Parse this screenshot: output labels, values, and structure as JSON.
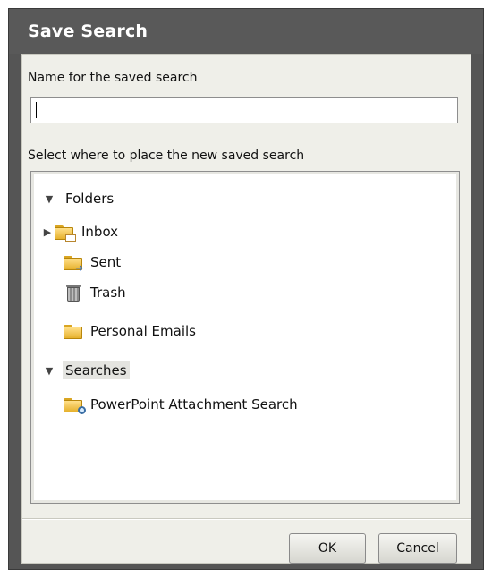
{
  "dialog": {
    "title": "Save Search"
  },
  "name_field": {
    "label": "Name for the saved search",
    "value": ""
  },
  "location": {
    "label": "Select where to place the new saved search"
  },
  "tree": {
    "folders": {
      "label": "Folders",
      "twisty": "▼",
      "items": [
        {
          "label": "Inbox",
          "icon": "inbox-folder-icon",
          "twisty": "▶"
        },
        {
          "label": "Sent",
          "icon": "sent-folder-icon"
        },
        {
          "label": "Trash",
          "icon": "trash-icon"
        },
        {
          "label": "Personal Emails",
          "icon": "folder-icon"
        }
      ]
    },
    "searches": {
      "label": "Searches",
      "twisty": "▼",
      "items": [
        {
          "label": "PowerPoint Attachment Search",
          "icon": "saved-search-folder-icon"
        }
      ]
    }
  },
  "buttons": {
    "ok": "OK",
    "cancel": "Cancel"
  },
  "colors": {
    "titlebar": "#595959",
    "dialog_body": "#efefe9",
    "selected_row": "#e4e4e0"
  }
}
